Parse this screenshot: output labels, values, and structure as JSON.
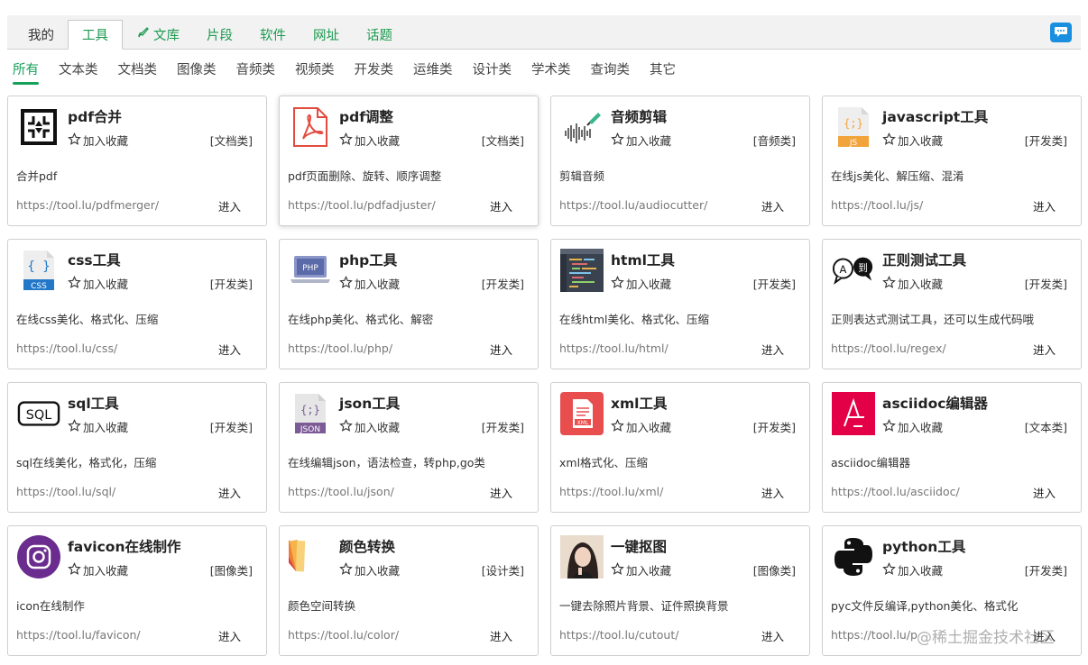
{
  "top_tabs": [
    {
      "label": "我的",
      "style": "plain"
    },
    {
      "label": "工具",
      "style": "active"
    },
    {
      "label": "文库",
      "style": "link",
      "icon": "brush-icon"
    },
    {
      "label": "片段",
      "style": "link"
    },
    {
      "label": "软件",
      "style": "link"
    },
    {
      "label": "网址",
      "style": "link"
    },
    {
      "label": "话题",
      "style": "link"
    }
  ],
  "category_tabs": [
    "所有",
    "文本类",
    "文档类",
    "图像类",
    "音频类",
    "视频类",
    "开发类",
    "运维类",
    "设计类",
    "学术类",
    "查询类",
    "其它"
  ],
  "fav_label": "加入收藏",
  "enter_label": "进入",
  "cards": [
    {
      "title": "pdf合并",
      "category": "[文档类]",
      "desc": "合并pdf",
      "url": "https://tool.lu/pdfmerger/",
      "icon": "pdf-merge-icon"
    },
    {
      "title": "pdf调整",
      "category": "[文档类]",
      "desc": "pdf页面删除、旋转、顺序调整",
      "url": "https://tool.lu/pdfadjuster/",
      "icon": "pdf-icon"
    },
    {
      "title": "音频剪辑",
      "category": "[音频类]",
      "desc": "剪辑音频",
      "url": "https://tool.lu/audiocutter/",
      "icon": "audio-wave-icon"
    },
    {
      "title": "javascript工具",
      "category": "[开发类]",
      "desc": "在线js美化、解压缩、混淆",
      "url": "https://tool.lu/js/",
      "icon": "js-file-icon"
    },
    {
      "title": "css工具",
      "category": "[开发类]",
      "desc": "在线css美化、格式化、压缩",
      "url": "https://tool.lu/css/",
      "icon": "css-file-icon"
    },
    {
      "title": "php工具",
      "category": "[开发类]",
      "desc": "在线php美化、格式化、解密",
      "url": "https://tool.lu/php/",
      "icon": "php-laptop-icon"
    },
    {
      "title": "html工具",
      "category": "[开发类]",
      "desc": "在线html美化、格式化、压缩",
      "url": "https://tool.lu/html/",
      "icon": "code-editor-icon"
    },
    {
      "title": "正则测试工具",
      "category": "[开发类]",
      "desc": "正则表达式测试工具，还可以生成代码哦",
      "url": "https://tool.lu/regex/",
      "icon": "regex-bubbles-icon"
    },
    {
      "title": "sql工具",
      "category": "[开发类]",
      "desc": "sql在线美化，格式化，压缩",
      "url": "https://tool.lu/sql/",
      "icon": "sql-icon"
    },
    {
      "title": "json工具",
      "category": "[开发类]",
      "desc": "在线编辑json，语法检查，转php,go类",
      "url": "https://tool.lu/json/",
      "icon": "json-file-icon"
    },
    {
      "title": "xml工具",
      "category": "[开发类]",
      "desc": "xml格式化、压缩",
      "url": "https://tool.lu/xml/",
      "icon": "xml-file-icon"
    },
    {
      "title": "asciidoc编辑器",
      "category": "[文本类]",
      "desc": "asciidoc编辑器",
      "url": "https://tool.lu/asciidoc/",
      "icon": "asciidoc-icon"
    },
    {
      "title": "favicon在线制作",
      "category": "[图像类]",
      "desc": "icon在线制作",
      "url": "https://tool.lu/favicon/",
      "icon": "instagram-like-icon"
    },
    {
      "title": "颜色转换",
      "category": "[设计类]",
      "desc": "颜色空间转换",
      "url": "https://tool.lu/color/",
      "icon": "color-swatch-icon"
    },
    {
      "title": "一键抠图",
      "category": "[图像类]",
      "desc": "一键去除照片背景、证件照换背景",
      "url": "https://tool.lu/cutout/",
      "icon": "portrait-photo-icon"
    },
    {
      "title": "python工具",
      "category": "[开发类]",
      "desc": "pyc文件反编译,python美化、格式化",
      "url": "https://tool.lu/p",
      "icon": "python-logo-icon"
    }
  ],
  "watermark": "@稀土掘金技术社区",
  "colors": {
    "accent_green": "#16a05a",
    "chat_blue": "#1a8fe0"
  }
}
